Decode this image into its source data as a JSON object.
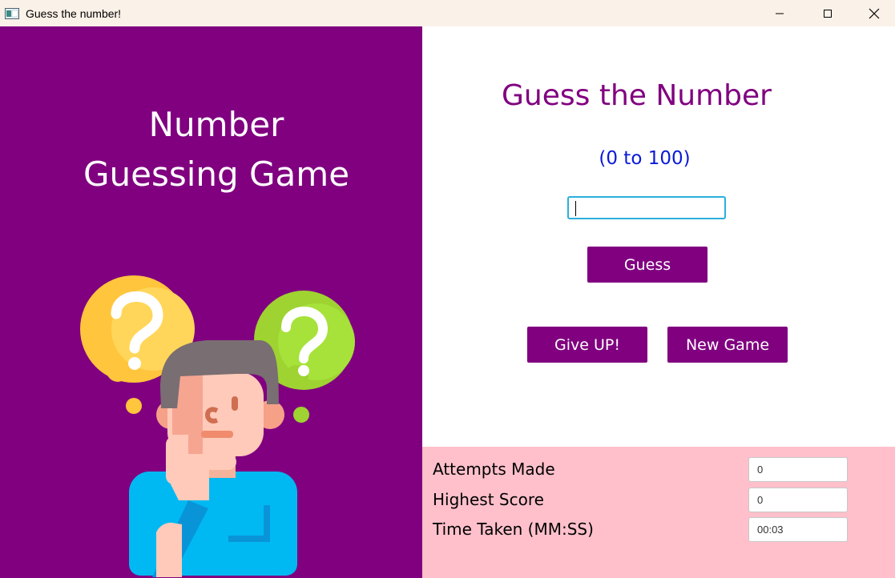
{
  "window": {
    "title": "Guess the number!",
    "icons": [
      "app-icon",
      "minimize-icon",
      "maximize-icon",
      "close-icon"
    ]
  },
  "left_panel": {
    "title_line1": "Number",
    "title_line2": "Guessing Game",
    "background": "#800080",
    "illustration": "thinking-person-with-question-marks"
  },
  "game": {
    "title": "Guess the Number",
    "range": "(0 to 100)",
    "guess_value": "",
    "guess_button": "Guess",
    "give_up_button": "Give UP!",
    "new_game_button": "New Game",
    "accent": "#800080",
    "range_color": "#0a19d8"
  },
  "stats": {
    "background": "#ffc0cb",
    "attempts_label": "Attempts Made",
    "attempts_value": "0",
    "highest_label": "Highest Score",
    "highest_value": "0",
    "time_label": "Time Taken (MM:SS)",
    "time_value": "00:03"
  }
}
